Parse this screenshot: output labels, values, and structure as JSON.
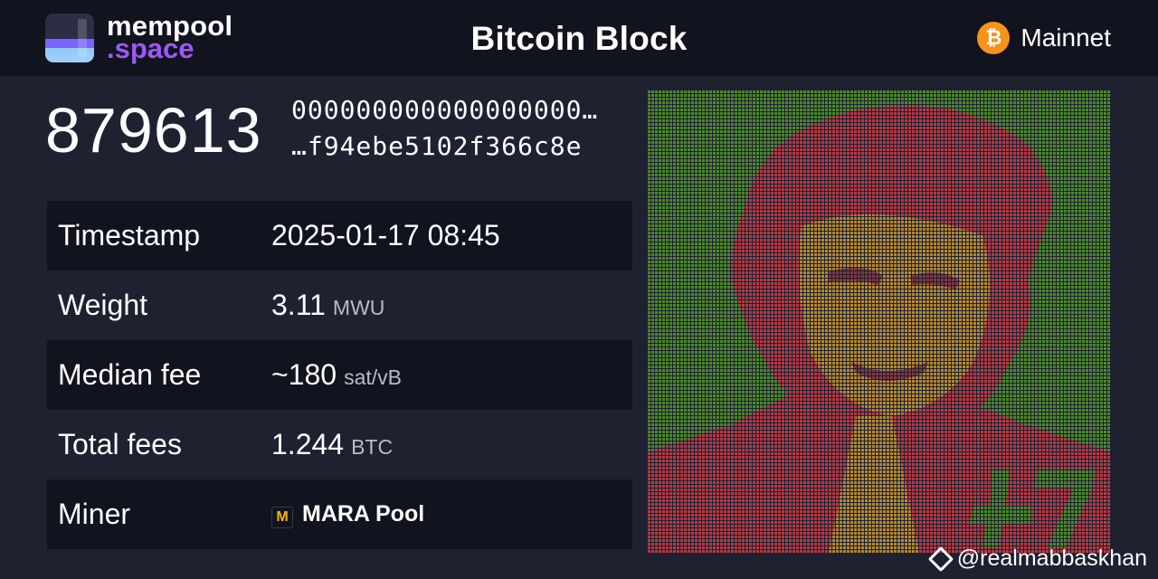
{
  "header": {
    "logo_line1": "mempool",
    "logo_line2": ".space",
    "title": "Bitcoin Block",
    "network_icon": "bitcoin-icon",
    "network_label": "Mainnet"
  },
  "block": {
    "height": "879613",
    "hash_line1": "000000000000000000…",
    "hash_line2": "…f94ebe5102f366c8e"
  },
  "details": {
    "timestamp_label": "Timestamp",
    "timestamp_value": "2025-01-17 08:45",
    "weight_label": "Weight",
    "weight_value": "3.11",
    "weight_unit": "MWU",
    "median_fee_label": "Median fee",
    "median_fee_value": "~180",
    "median_fee_unit": "sat/vB",
    "total_fees_label": "Total fees",
    "total_fees_value": "1.244",
    "total_fees_unit": "BTC",
    "miner_label": "Miner",
    "miner_icon": "M",
    "miner_value": "MARA Pool"
  },
  "colors": {
    "background": "#1d2130",
    "header_bg": "#11131f",
    "logo_accent": "#9e58f7",
    "bitcoin_orange": "#f7931a",
    "grid_green": "#4d8a2a",
    "grid_red": "#b83a45",
    "grid_orange": "#b88a2e"
  },
  "watermark": {
    "text": "@realmabbaskhan",
    "icon": "binance-icon"
  }
}
